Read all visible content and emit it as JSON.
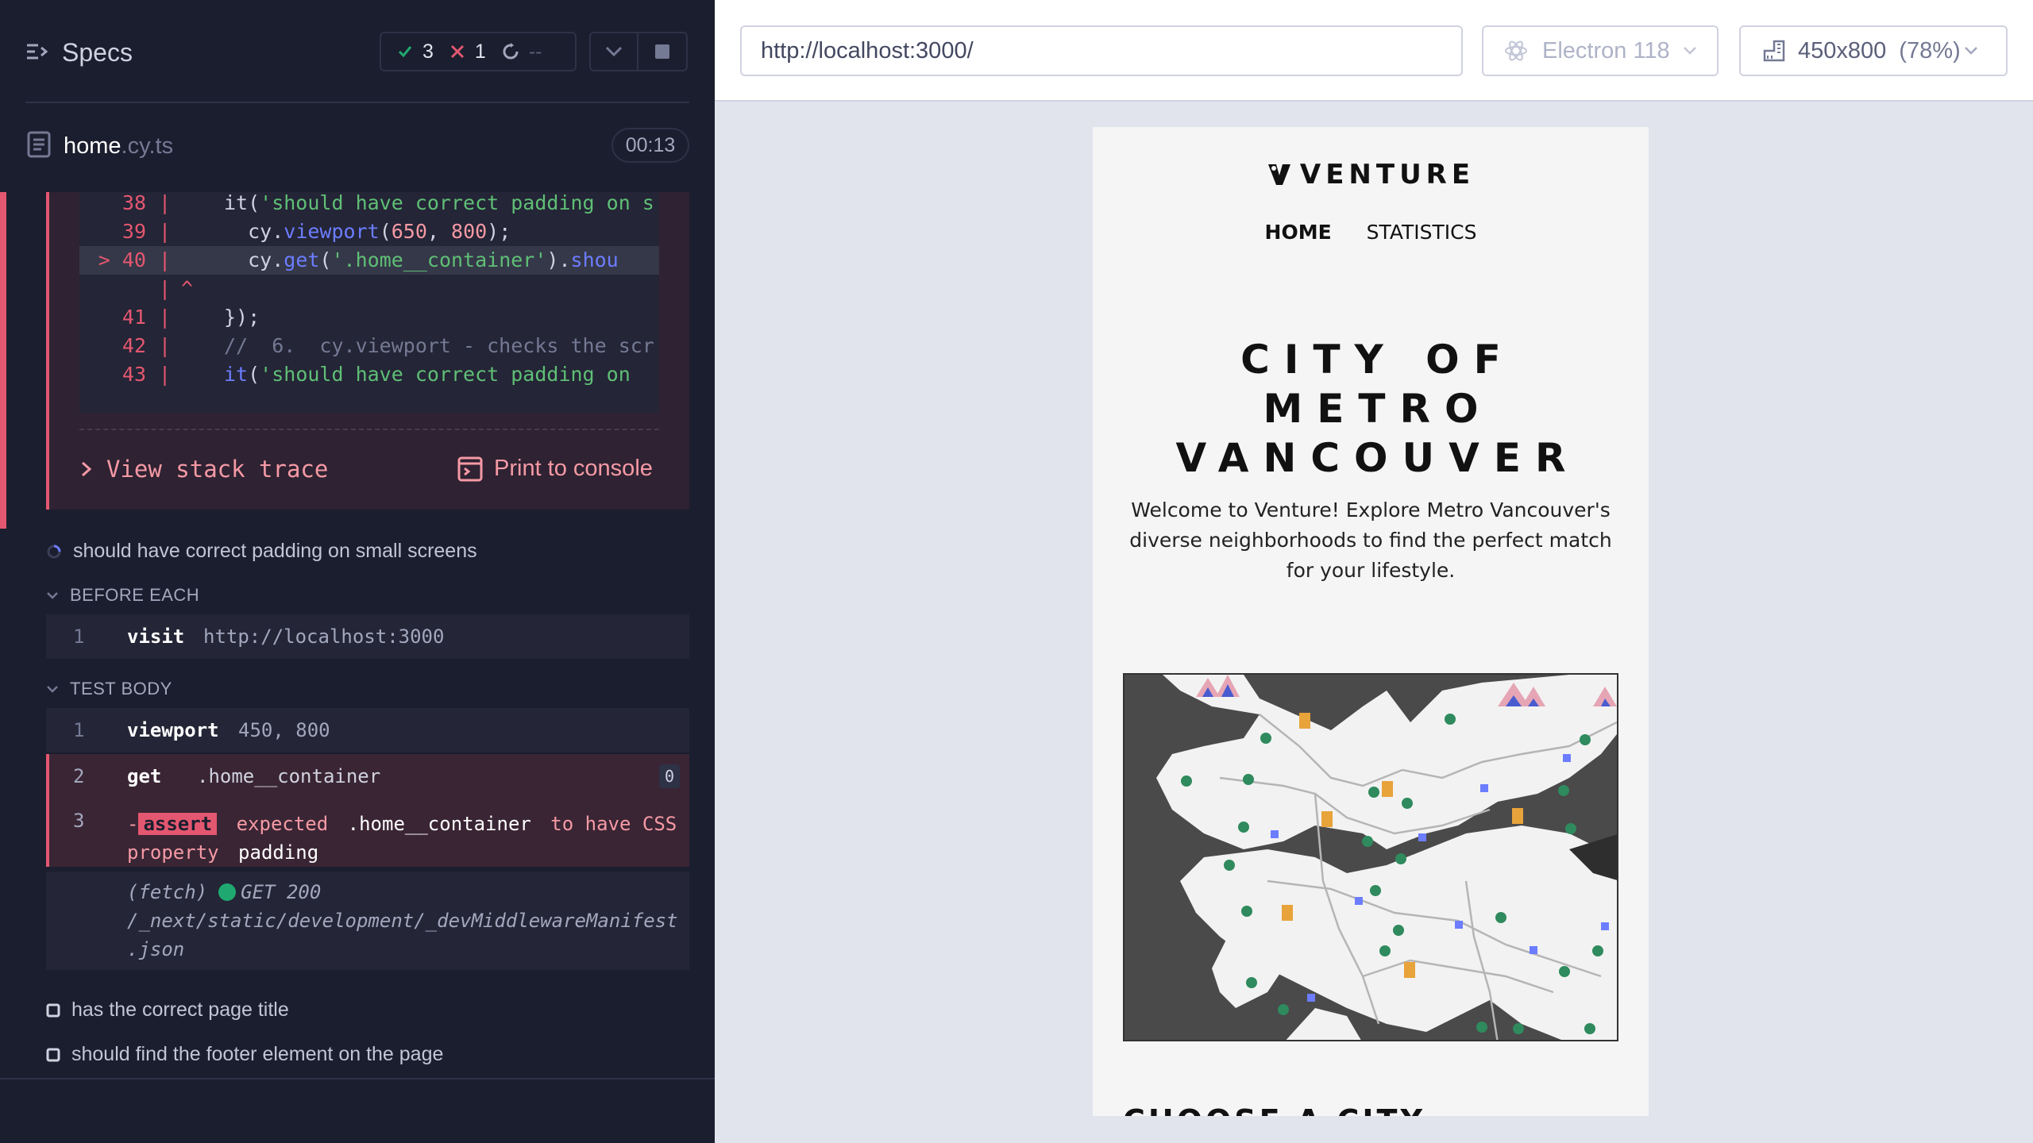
{
  "reporter": {
    "title": "Specs",
    "stats": {
      "passed": "3",
      "failed": "1",
      "pending": "--"
    },
    "spec": {
      "name": "home",
      "ext": ".cy.ts",
      "duration": "00:13"
    },
    "code_frame": [
      {
        "line": "38",
        "marker": "",
        "parts": [
          [
            "",
            "it("
          ],
          [
            "str",
            "'should have correct padding on s"
          ]
        ]
      },
      {
        "line": "39",
        "marker": "",
        "parts": [
          [
            "",
            "  cy."
          ],
          [
            "fn",
            "viewport"
          ],
          [
            "",
            "("
          ],
          [
            "num",
            "650"
          ],
          [
            "",
            ", "
          ],
          [
            "num",
            "800"
          ],
          [
            "",
            ");"
          ]
        ]
      },
      {
        "line": "40",
        "marker": ">",
        "parts": [
          [
            "",
            "  cy."
          ],
          [
            "fn",
            "get"
          ],
          [
            "",
            "("
          ],
          [
            "str",
            "'.home__container'"
          ],
          [
            "",
            ")."
          ],
          [
            "fn",
            "shou"
          ]
        ]
      },
      {
        "line": "",
        "marker": "",
        "caret": "^",
        "parts": []
      },
      {
        "line": "41",
        "marker": "",
        "parts": [
          [
            "",
            "});"
          ]
        ]
      },
      {
        "line": "42",
        "marker": "",
        "parts": [
          [
            "cmt",
            "//  6.  cy.viewport - checks the scr"
          ]
        ]
      },
      {
        "line": "43",
        "marker": "",
        "parts": [
          [
            "fn",
            "it"
          ],
          [
            "",
            "("
          ],
          [
            "str",
            "'should have correct padding on "
          ]
        ]
      }
    ],
    "view_stack_trace": "View stack trace",
    "print_to_console": "Print to console",
    "running_test": "should have correct padding on small screens",
    "before_each_label": "BEFORE EACH",
    "before_each_cmd": {
      "num": "1",
      "name": "visit",
      "msg": "http://localhost:3000"
    },
    "test_body_label": "TEST BODY",
    "cmd1": {
      "num": "1",
      "name": "viewport",
      "msg": "450, 800"
    },
    "cmd2": {
      "num": "2",
      "name": "get",
      "msg": ".home__container",
      "badge": "0"
    },
    "cmd3": {
      "num": "3",
      "prefix": "-",
      "tag": "assert",
      "text1": "expected",
      "subject": ".home__container",
      "text2": "to have CSS",
      "text3": "property",
      "prop": "padding"
    },
    "fetch": {
      "label": "(fetch)",
      "status": "GET 200",
      "path1": "/_next/static/development/_devMiddlewareManifest",
      "path2": ".json"
    },
    "pending_tests": [
      "has the correct page title",
      "should find the footer element on the page"
    ]
  },
  "aut": {
    "url": "http://localhost:3000/",
    "browser": "Electron 118",
    "viewport": "450x800",
    "scale": "(78%)"
  },
  "app": {
    "logo": "VENTURE",
    "nav": [
      "HOME",
      "STATISTICS"
    ],
    "hero": [
      "CITY OF",
      "METRO",
      "VANCOUVER"
    ],
    "intro": [
      "Welcome to Venture! Explore Metro Vancouver's",
      "diverse neighborhoods to find the perfect match",
      "for your lifestyle."
    ],
    "next_section": "CHOOSE A CITY"
  },
  "colors": {
    "panel_bg": "#1b1e2e",
    "failed": "#e45770",
    "passed": "#1fa971",
    "accent": "#6c7dff"
  }
}
